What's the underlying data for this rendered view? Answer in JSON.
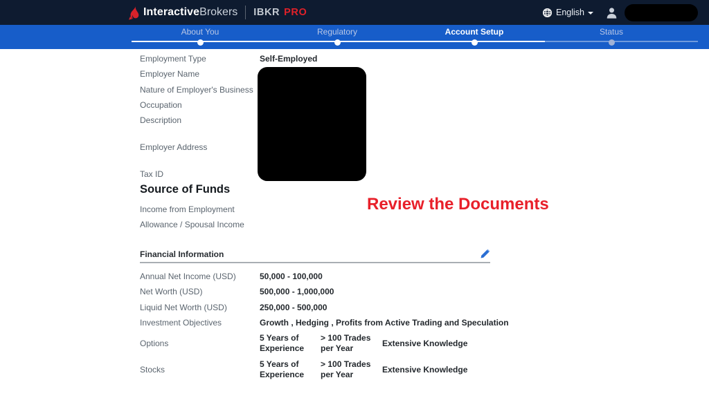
{
  "header": {
    "brand_interactive": "Interactive",
    "brand_brokers": "Brokers",
    "plan_ibkr": "IBKR",
    "plan_pro": "PRO",
    "language_label": "English"
  },
  "colors": {
    "header_bg": "#0e1b30",
    "stepper_bg": "#175dc9",
    "brand_red": "#e02129",
    "annotation_red": "#e8202a",
    "edit_icon_blue": "#2a6fd4"
  },
  "stepper": {
    "steps": [
      {
        "label": "About You",
        "state": "done"
      },
      {
        "label": "Regulatory",
        "state": "done"
      },
      {
        "label": "Account Setup",
        "state": "active"
      },
      {
        "label": "Status",
        "state": "upcoming"
      }
    ]
  },
  "employment": {
    "rows": [
      {
        "label": "Employment Type",
        "value": "Self-Employed"
      },
      {
        "label": "Employer Name",
        "value": ""
      },
      {
        "label": "Nature of Employer's Business",
        "value": ""
      },
      {
        "label": "Occupation",
        "value": ""
      },
      {
        "label": "Description",
        "value": ""
      },
      {
        "label": "Employer Address",
        "value": ""
      },
      {
        "label": "Tax ID",
        "value": ""
      }
    ]
  },
  "source_of_funds": {
    "title": "Source of Funds",
    "items": [
      {
        "label": "Income from Employment"
      },
      {
        "label": "Allowance / Spousal Income"
      }
    ]
  },
  "annotation": {
    "text": "Review the Documents"
  },
  "financial": {
    "title": "Financial Information",
    "rows": [
      {
        "label": "Annual Net Income (USD)",
        "value": "50,000 - 100,000"
      },
      {
        "label": "Net Worth (USD)",
        "value": "500,000 - 1,000,000"
      },
      {
        "label": "Liquid Net Worth (USD)",
        "value": "250,000 - 500,000"
      },
      {
        "label": "Investment Objectives",
        "value": "Growth , Hedging , Profits from Active Trading and Speculation"
      }
    ],
    "experience_rows": [
      {
        "label": "Options",
        "years": "5 Years of Experience",
        "trades": "> 100 Trades per Year",
        "knowledge": "Extensive Knowledge"
      },
      {
        "label": "Stocks",
        "years": "5 Years of Experience",
        "trades": "> 100 Trades per Year",
        "knowledge": "Extensive Knowledge"
      }
    ]
  }
}
